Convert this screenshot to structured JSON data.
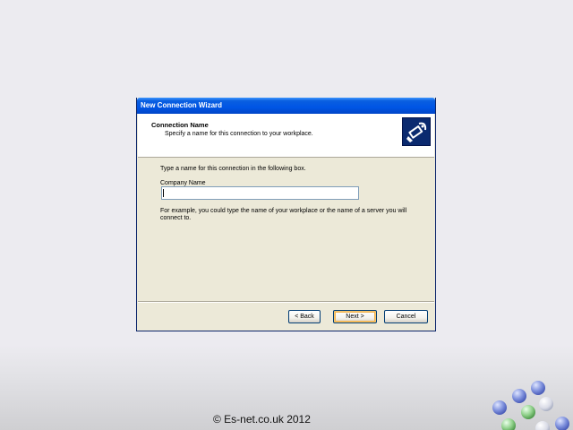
{
  "window": {
    "title": "New Connection Wizard"
  },
  "header": {
    "title": "Connection Name",
    "subtitle": "Specify a name for this connection to your workplace.",
    "icon": "network-connection-icon"
  },
  "content": {
    "instruction": "Type a name for this connection in the following box.",
    "field_label": "Company Name",
    "field_value": "",
    "example": "For example, you could type the name of your workplace or the name of a server you will connect to."
  },
  "buttons": {
    "back": "< Back",
    "next": "Next >",
    "cancel": "Cancel"
  },
  "footer": {
    "copyright": "© Es-net.co.uk 2012"
  },
  "colors": {
    "titlebar": "#0055e5",
    "dialog_bg": "#ece9d8",
    "page_bg": "#ecebf0"
  }
}
